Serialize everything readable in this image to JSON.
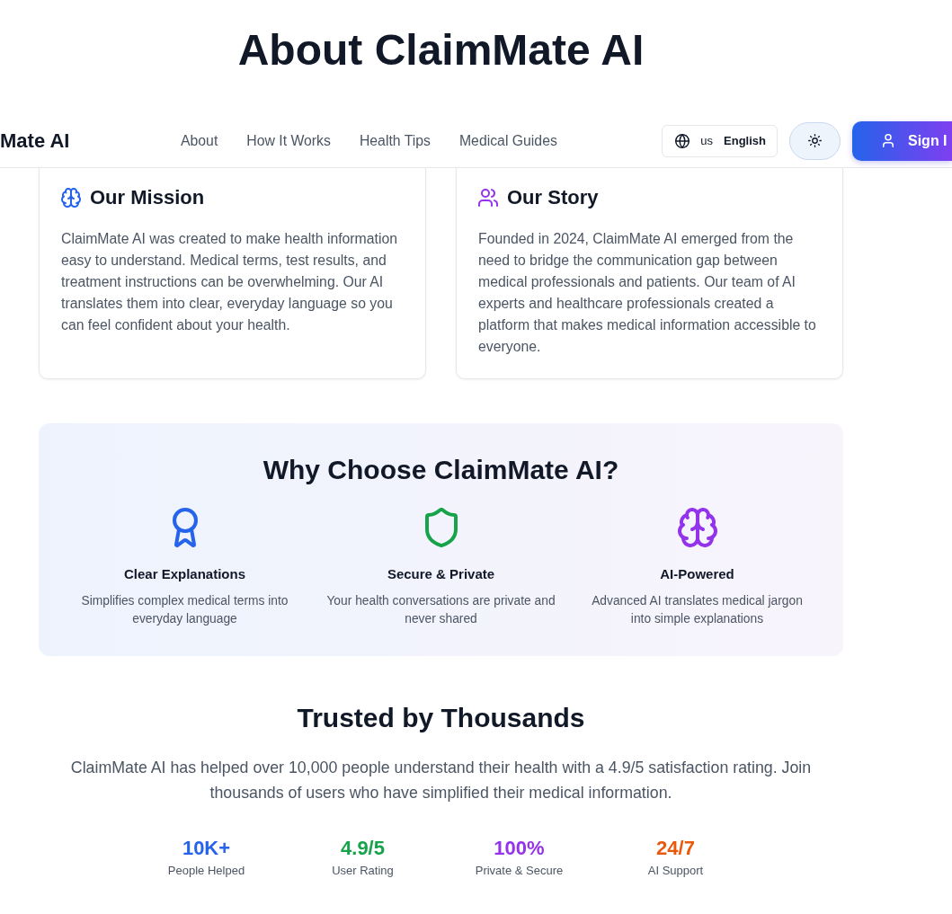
{
  "page_title": "About ClaimMate AI",
  "header": {
    "logo": "Mate AI",
    "nav": [
      "About",
      "How It Works",
      "Health Tips",
      "Medical Guides"
    ],
    "language": {
      "code": "us",
      "label": "English"
    },
    "sign_in": "Sign I"
  },
  "cards": [
    {
      "title": "Our Mission",
      "color": "#2563eb",
      "text": "ClaimMate AI was created to make health information easy to understand. Medical terms, test results, and treatment instructions can be overwhelming. Our AI translates them into clear, everyday language so you can feel confident about your health."
    },
    {
      "title": "Our Story",
      "color": "#9333ea",
      "text": "Founded in 2024, ClaimMate AI emerged from the need to bridge the communication gap between medical professionals and patients. Our team of AI experts and healthcare professionals created a platform that makes medical information accessible to everyone."
    }
  ],
  "why_choose": {
    "title": "Why Choose ClaimMate AI?",
    "features": [
      {
        "title": "Clear Explanations",
        "text": "Simplifies complex medical terms into everyday language",
        "color": "#2563eb"
      },
      {
        "title": "Secure & Private",
        "text": "Your health conversations are private and never shared",
        "color": "#16a34a"
      },
      {
        "title": "AI-Powered",
        "text": "Advanced AI translates medical jargon into simple explanations",
        "color": "#9333ea"
      }
    ]
  },
  "trusted": {
    "title": "Trusted by Thousands",
    "text": "ClaimMate AI has helped over 10,000 people understand their health with a 4.9/5 satisfaction rating. Join thousands of users who have simplified their medical information.",
    "stats": [
      {
        "value": "10K+",
        "label": "People Helped",
        "color": "#2563eb"
      },
      {
        "value": "4.9/5",
        "label": "User Rating",
        "color": "#16a34a"
      },
      {
        "value": "100%",
        "label": "Private & Secure",
        "color": "#9333ea"
      },
      {
        "value": "24/7",
        "label": "AI Support",
        "color": "#ea580c"
      }
    ]
  }
}
